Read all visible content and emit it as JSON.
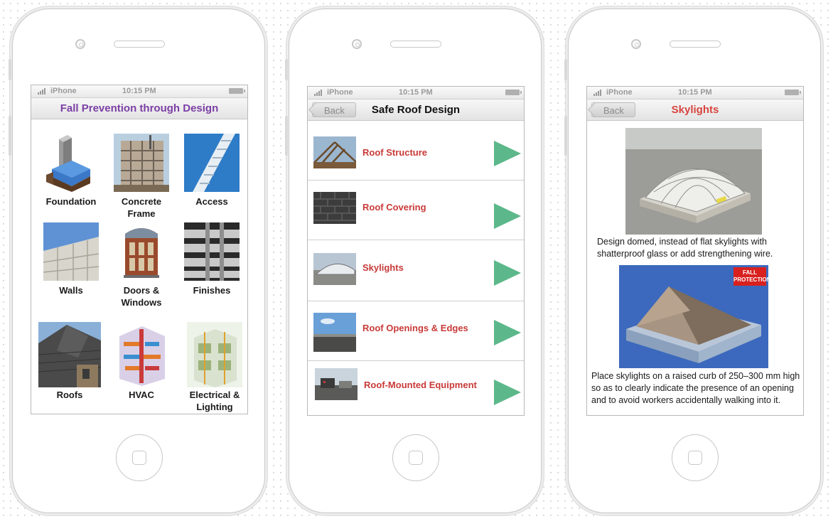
{
  "status": {
    "carrier": "iPhone",
    "time": "10:15 PM"
  },
  "screen1": {
    "title": "Fall Prevention through Design",
    "title_color": "#7b3fa5",
    "tiles": [
      {
        "label": "Foundation"
      },
      {
        "label": "Concrete Frame"
      },
      {
        "label": "Access"
      },
      {
        "label": "Walls"
      },
      {
        "label": "Doors & Windows"
      },
      {
        "label": "Finishes"
      },
      {
        "label": "Roofs"
      },
      {
        "label": "HVAC"
      },
      {
        "label": "Electrical & Lighting"
      }
    ]
  },
  "screen2": {
    "back_label": "Back",
    "title": "Safe Roof Design",
    "rows": [
      {
        "label": "Roof Structure"
      },
      {
        "label": "Roof Covering"
      },
      {
        "label": "Skylights"
      },
      {
        "label": "Roof Openings & Edges"
      },
      {
        "label": "Roof-Mounted Equipment"
      }
    ],
    "label_color": "#c83a38",
    "arrow_color": "#5cb88a"
  },
  "screen3": {
    "back_label": "Back",
    "title": "Skylights",
    "title_color": "#d8453f",
    "para1": "Design domed, instead of flat skylights with shatterproof glass or add strengthening wire.",
    "para2": "Place skylights on a raised curb of 250–300 mm high so as to clearly indicate the presence of an opening and to avoid workers accidentally walking into it.",
    "badge": "FALL PROTECTION"
  }
}
